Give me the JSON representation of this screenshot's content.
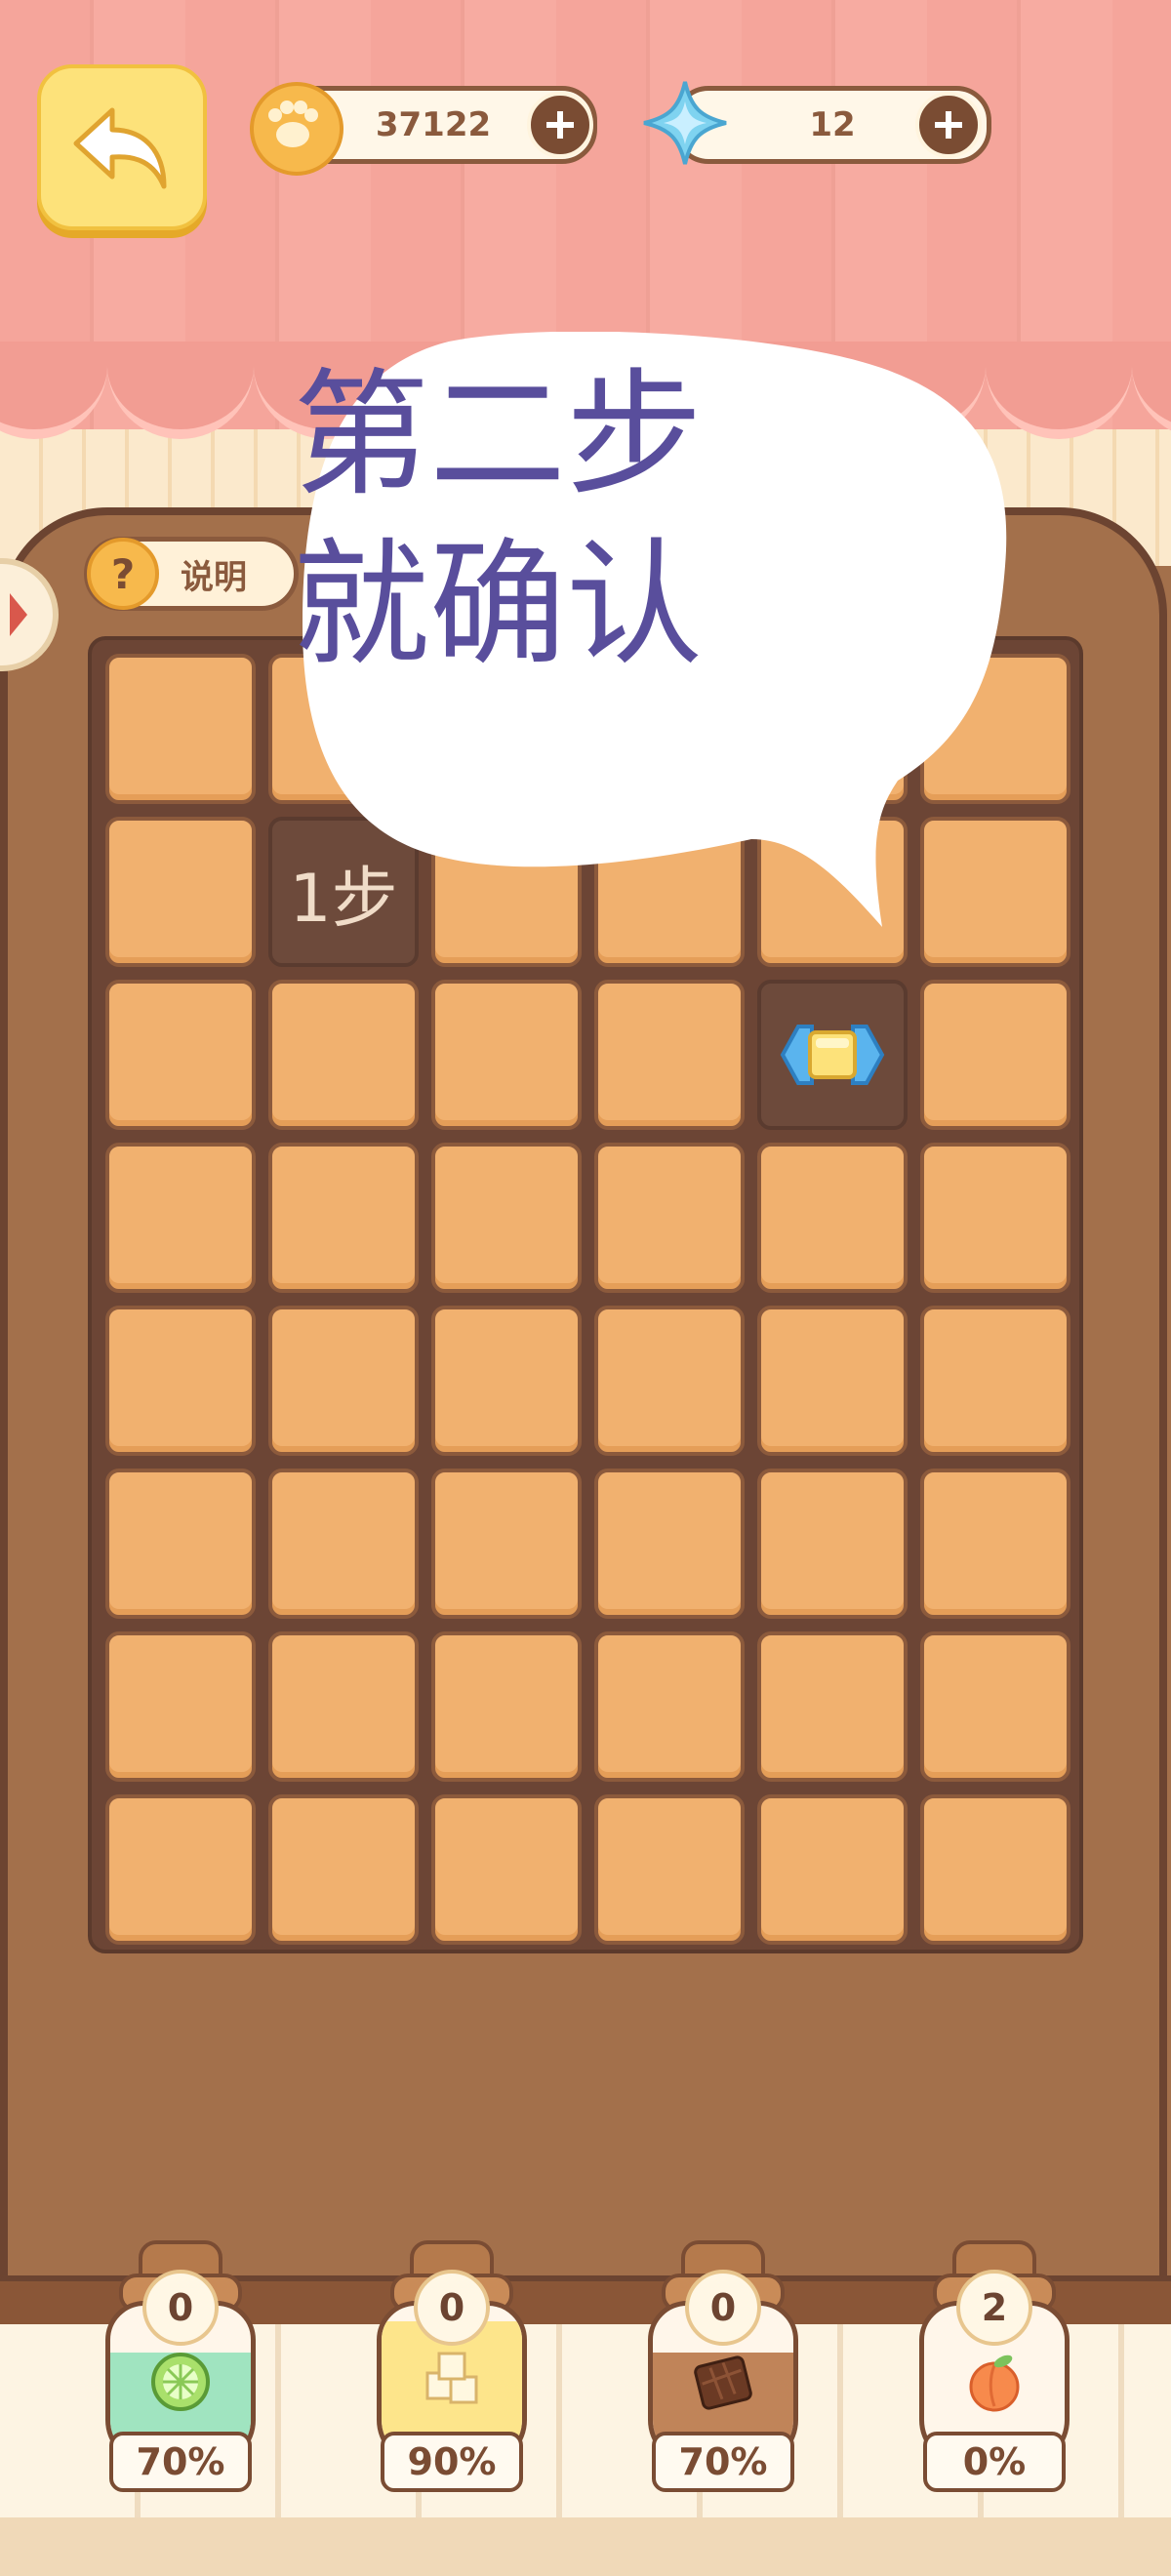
{
  "hud": {
    "coins": "37122",
    "gems": "12"
  },
  "help": {
    "label": "说明",
    "icon_text": "?"
  },
  "bubble": {
    "text_line1": "第二步",
    "text_line2": "就确认"
  },
  "board": {
    "rows": 8,
    "cols": 6,
    "step_label": "1步",
    "step_cell": [
      1,
      1
    ],
    "item_cell": [
      2,
      4
    ]
  },
  "jars": [
    {
      "count": "0",
      "percent": "70%",
      "item": "lime-icon",
      "fill_color": "#8fe0b9",
      "fill_level": 0.7
    },
    {
      "count": "0",
      "percent": "90%",
      "item": "sugar-cube-icon",
      "fill_color": "#fde27a",
      "fill_level": 0.9
    },
    {
      "count": "0",
      "percent": "70%",
      "item": "chocolate-icon",
      "fill_color": "#b5703f",
      "fill_level": 0.7
    },
    {
      "count": "2",
      "percent": "0%",
      "item": "peach-icon",
      "fill_color": "#fff6ea",
      "fill_level": 0.0
    }
  ],
  "colors": {
    "tile": "#f1b16f",
    "tile_dark": "#6d4a3b",
    "bubble_text": "#594e9c",
    "curtain": "#f5a59b"
  }
}
